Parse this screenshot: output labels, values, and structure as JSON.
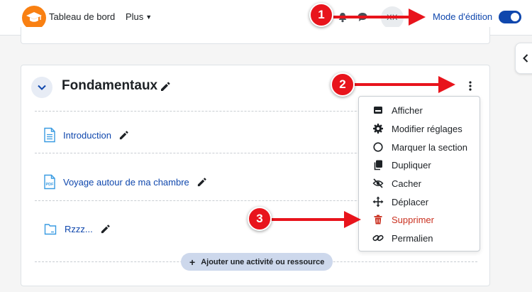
{
  "navbar": {
    "title": "Tableau de bord",
    "more_label": "Plus",
    "avatar_initials": "XX",
    "edit_mode_label": "Mode d'édition",
    "edit_mode_on": true
  },
  "section": {
    "title": "Fondamentaux",
    "activities": [
      {
        "name": "Introduction",
        "icon": "page-icon"
      },
      {
        "name": "Voyage autour de ma chambre",
        "icon": "pdf-icon"
      },
      {
        "name": "Rzzz...",
        "icon": "folder-icon"
      }
    ],
    "add_activity_label": "Ajouter une activité ou ressource"
  },
  "menu": {
    "items": [
      {
        "label": "Afficher",
        "icon": "display-icon"
      },
      {
        "label": "Modifier réglages",
        "icon": "gear-icon"
      },
      {
        "label": "Marquer la section",
        "icon": "circle-icon"
      },
      {
        "label": "Dupliquer",
        "icon": "copy-icon"
      },
      {
        "label": "Cacher",
        "icon": "eye-slash-icon"
      },
      {
        "label": "Déplacer",
        "icon": "move-icon"
      },
      {
        "label": "Supprimer",
        "icon": "trash-icon",
        "danger": true
      },
      {
        "label": "Permalien",
        "icon": "link-icon"
      }
    ]
  },
  "annotations": [
    "1",
    "2",
    "3"
  ],
  "colors": {
    "accent": "#0f47ad",
    "logo": "#f98012",
    "danger": "#ca3120",
    "annotation_red": "#e8141c"
  }
}
